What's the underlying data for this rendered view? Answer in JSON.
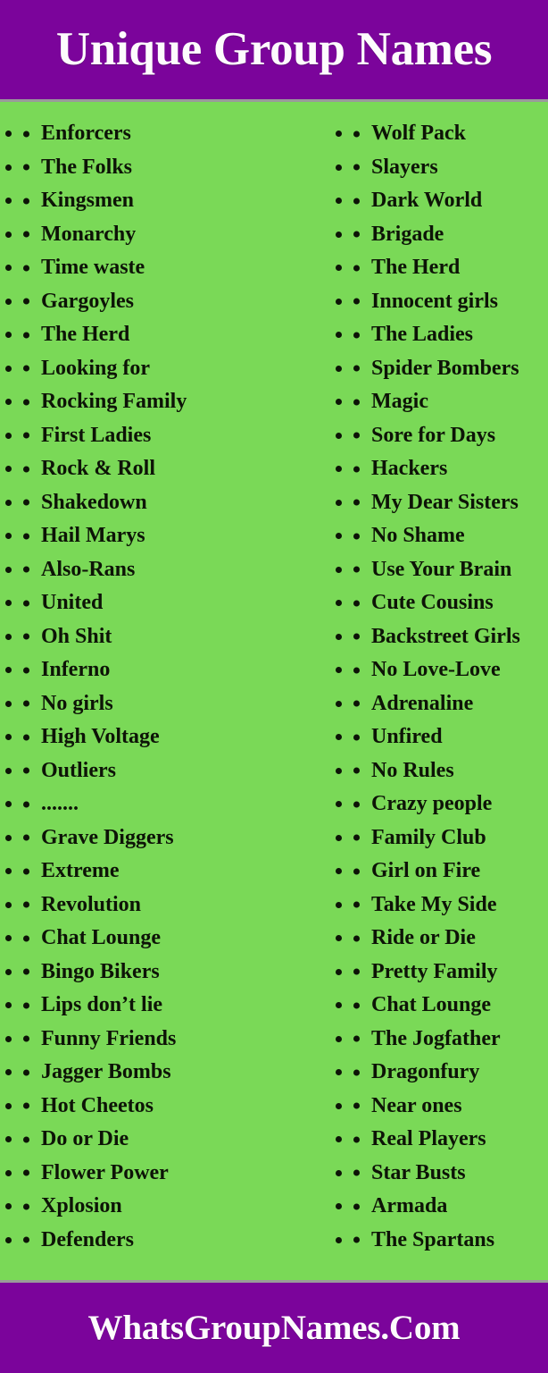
{
  "colors": {
    "purple": "#7b049b",
    "green": "#7ad957",
    "text_dark": "#0d1407",
    "text_light": "#fdfbfd",
    "divider_gray": "#9a9a9a"
  },
  "header": {
    "title": "Unique Group Names"
  },
  "footer": {
    "site": "WhatsGroupNames.Com"
  },
  "list": {
    "bullet_glyph": "•",
    "left_column": [
      {
        "label": "Enforcers"
      },
      {
        "label": "The Folks"
      },
      {
        "label": "Kingsmen"
      },
      {
        "label": "Monarchy"
      },
      {
        "label": "Time waste"
      },
      {
        "label": "Gargoyles"
      },
      {
        "label": "The Herd"
      },
      {
        "label": "Looking for"
      },
      {
        "label": "Rocking Family"
      },
      {
        "label": "First Ladies"
      },
      {
        "label": "Rock & Roll"
      },
      {
        "label": "Shakedown"
      },
      {
        "label": "Hail Marys"
      },
      {
        "label": "Also-Rans"
      },
      {
        "label": "United"
      },
      {
        "label": "Oh Shit"
      },
      {
        "label": "Inferno"
      },
      {
        "label": "No girls"
      },
      {
        "label": "High Voltage"
      },
      {
        "label": "Outliers"
      },
      {
        "label": "......."
      },
      {
        "label": "Grave Diggers"
      },
      {
        "label": "Extreme"
      },
      {
        "label": "Revolution"
      },
      {
        "label": "Chat Lounge"
      },
      {
        "label": "Bingo Bikers"
      },
      {
        "label": "Lips don’t lie"
      },
      {
        "label": "Funny Friends"
      },
      {
        "label": "Jagger Bombs"
      },
      {
        "label": "Hot Cheetos"
      },
      {
        "label": "Do or Die"
      },
      {
        "label": "Flower Power"
      },
      {
        "label": "Xplosion"
      },
      {
        "label": "Defenders"
      }
    ],
    "right_column": [
      {
        "label": "Wolf Pack"
      },
      {
        "label": "Slayers"
      },
      {
        "label": "Dark World"
      },
      {
        "label": "Brigade"
      },
      {
        "label": "The Herd"
      },
      {
        "label": "Innocent girls"
      },
      {
        "label": "The Ladies"
      },
      {
        "label": "Spider Bombers"
      },
      {
        "label": "Magic"
      },
      {
        "label": "Sore for Days"
      },
      {
        "label": "Hackers"
      },
      {
        "label": "My Dear Sisters"
      },
      {
        "label": "No Shame"
      },
      {
        "label": "Use Your Brain"
      },
      {
        "label": "Cute Cousins"
      },
      {
        "label": "Backstreet Girls"
      },
      {
        "label": "No Love-Love"
      },
      {
        "label": "Adrenaline"
      },
      {
        "label": "Unfired"
      },
      {
        "label": "No Rules"
      },
      {
        "label": "Crazy people"
      },
      {
        "label": "Family Club"
      },
      {
        "label": "Girl on Fire"
      },
      {
        "label": "Take My Side"
      },
      {
        "label": "Ride or Die"
      },
      {
        "label": "Pretty Family"
      },
      {
        "label": "Chat Lounge"
      },
      {
        "label": "The Jogfather"
      },
      {
        "label": "Dragonfury"
      },
      {
        "label": "Near ones"
      },
      {
        "label": "Real Players"
      },
      {
        "label": "Star Busts"
      },
      {
        "label": "Armada"
      },
      {
        "label": "The Spartans"
      }
    ]
  }
}
